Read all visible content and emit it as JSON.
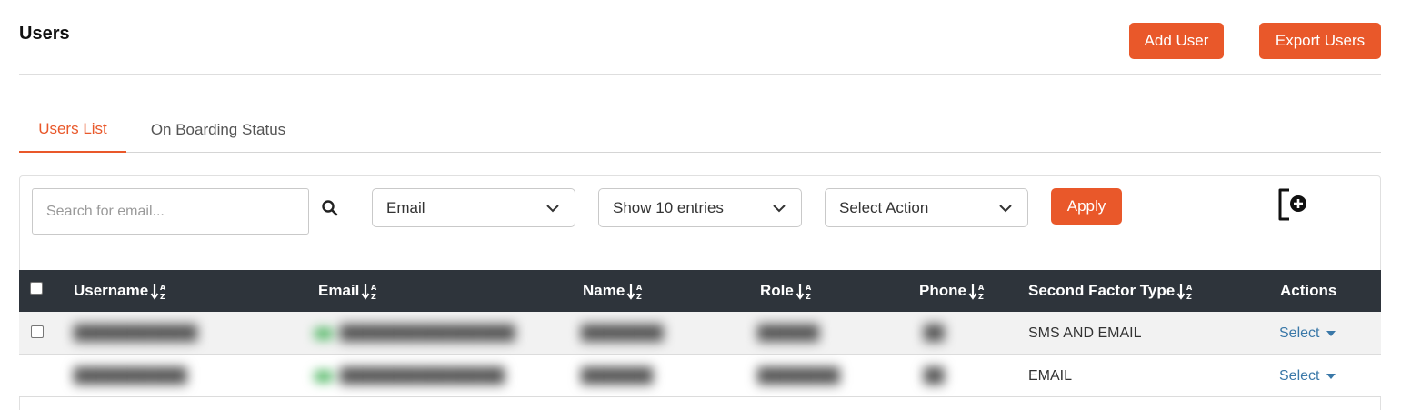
{
  "header": {
    "title": "Users",
    "add_user_label": "Add User",
    "export_users_label": "Export Users"
  },
  "tabs": [
    {
      "label": "Users List",
      "active": true
    },
    {
      "label": "On Boarding Status",
      "active": false
    }
  ],
  "toolbar": {
    "search_placeholder": "Search for email...",
    "search_value": "",
    "search_by": "Email",
    "entries": "Show 10 entries",
    "action": "Select Action",
    "apply_label": "Apply"
  },
  "table": {
    "columns": [
      "Username",
      "Email",
      "Name",
      "Role",
      "Phone",
      "Second Factor Type",
      "Actions"
    ],
    "rows": [
      {
        "username": "████████████",
        "email": "█████████████████",
        "name": "████████",
        "role": "██████",
        "phone": "██",
        "second_factor": "SMS AND EMAIL",
        "action": "Select"
      },
      {
        "username": "███████████",
        "email": "████████████████",
        "name": "███████",
        "role": "████████",
        "phone": "██",
        "second_factor": "EMAIL",
        "action": "Select"
      }
    ]
  },
  "colors": {
    "accent": "#e9582a",
    "table_header": "#2e343b",
    "link": "#3a78a8",
    "icons": [
      "search-icon",
      "chevron-down-icon",
      "file-add-icon",
      "sort-az-icon",
      "caret-down-icon"
    ]
  }
}
